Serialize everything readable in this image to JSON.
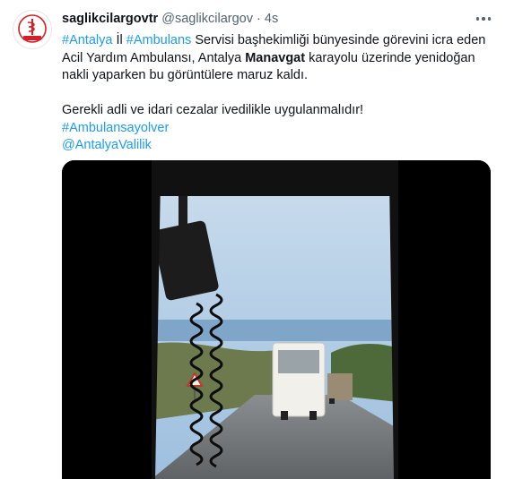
{
  "tweet": {
    "display_name": "saglikcilargovtr",
    "handle": "@saglikcilargov",
    "separator": "·",
    "time": "4s",
    "more_icon": "more-options-icon",
    "avatar": {
      "logo_icon": "ministry-of-health-logo",
      "logo_color": "#d61f26",
      "logo_text": "SAĞLIK BAKANLIĞI"
    },
    "text": {
      "hashtag_antalya": "#Antalya",
      "il": " İl ",
      "hashtag_ambulans": "#Ambulans",
      "line1_rest": " Servisi başhekimliği bünyesinde görevini icra eden",
      "line2_a": "Acil Yardım Ambulansı, Antalya ",
      "line2_bold": "Manavgat",
      "line2_b": " karayolu üzerinde yenidoğan",
      "line3": "nakli yaparken bu görüntülere maruz kaldı.",
      "line4": "Gerekli adli ve idari cezalar ivedilikle uygulanmalıdır!",
      "hashtag_line": "#Ambulansayolver",
      "mention_line": "@AntalyaValilik"
    },
    "video": {
      "description_icon": "video-frame",
      "colors": {
        "sky": "#a9c7e4",
        "road": "#7b7f82",
        "bus": "#f2f0ea",
        "link": "#1d9bf0"
      }
    }
  }
}
